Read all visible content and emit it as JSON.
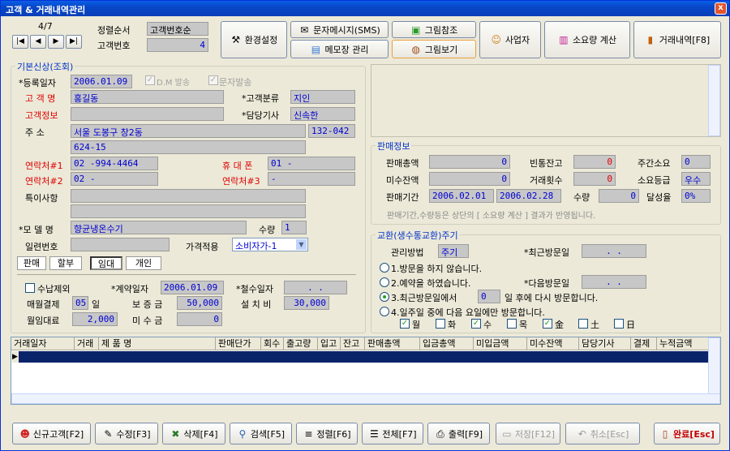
{
  "window": {
    "title": "고객 & 거래내역관리",
    "close": "x"
  },
  "nav": {
    "record": "4/7",
    "first": "|◀",
    "prev": "◀",
    "next": "▶",
    "last": "▶|",
    "sort_label": "정렬순서",
    "sort_value": "고객번호순",
    "custno_label": "고객번호",
    "custno_value": "4"
  },
  "toolbar": {
    "env": "환경설정",
    "sms": "문자메시지(SMS)",
    "photo_ref": "그림참조",
    "business": "사업자",
    "consumption": "소요량 계산",
    "trade": "거래내역[F8]",
    "memo": "메모장 관리",
    "photo_view": "그림보기"
  },
  "basic": {
    "title": "기본신상(조회)",
    "reg_date_label": "*등록일자",
    "reg_date": "2006.01.09",
    "dm_label": "D.M 발송",
    "sms_label": "문자발송",
    "name_label": "고 객 명",
    "name": "홍길동",
    "class_label": "*고객분류",
    "class_value": "지인",
    "info_label": "고객정보",
    "info": "",
    "driver_label": "*담당기사",
    "driver": "신속한",
    "addr_label": "주      소",
    "addr1": "서울 도봉구 창2동",
    "zip": "132-042",
    "addr2": "624-15",
    "tel1_label": "연락처#1",
    "tel1": "02  -994-4464",
    "mobile_label": "휴 대 폰",
    "mobile": "01  -",
    "tel2_label": "연락처#2",
    "tel2": "02  -",
    "tel3_label": "연락처#3",
    "tel3": "-",
    "note_label": "특이사항",
    "note1": "",
    "note2": "",
    "model_label": "*모 델 명",
    "model": "향균냉온수기",
    "qty_label": "수량",
    "qty": "1",
    "serial_label": "일련번호",
    "serial": "",
    "price_label": "가격적용",
    "price": "소비자가-1",
    "tabs": [
      "판매",
      "할부",
      "임대",
      "개인"
    ],
    "nocollect_label": "수납제외",
    "contract_label": "*계약일자",
    "contract": "2006.01.09",
    "withdraw_label": "*철수일자",
    "withdraw": ".   .",
    "monthly_label": "매월결제",
    "monthly_day": "05",
    "monthly_unit": "일",
    "deposit_label": "보 증 금",
    "deposit": "50,000",
    "install_label": "설 치 비",
    "install": "30,000",
    "rent_label": "월임대료",
    "rent": "2,000",
    "unpaid_label": "미 수 금",
    "unpaid": "0"
  },
  "sales": {
    "title": "판매정보",
    "total_label": "판매총액",
    "total": "0",
    "empty_label": "빈통잔고",
    "empty": "0",
    "cycle_label": "주간소요",
    "cycle": "0",
    "balance_label": "미수잔액",
    "balance": "0",
    "count_label": "거래횟수",
    "count": "0",
    "grade_label": "소요등급",
    "grade": "우수",
    "period_label": "판매기간",
    "period_from": "2006.02.01",
    "period_to": "2006.02.28",
    "qty_label": "수량",
    "qty": "0",
    "rate_label": "달성율",
    "rate": "0%",
    "note": "판매기간,수량등은 상단의 [ 소요량 계산 ] 결과가 반영됩니다."
  },
  "exchange": {
    "title": "교환(생수통교환)주기",
    "method_label": "관리방법",
    "method": "주기",
    "last_label": "*최근방문일",
    "last": ".   .",
    "next_label": "*다음방문일",
    "next": ".   .",
    "opt1": "1.방문을 하지 않습니다.",
    "opt2": "2.예약을 하였습니다.",
    "opt3a": "3.최근방문일에서",
    "opt3_days": "0",
    "opt3b": "일 후에 다시 방문합니다.",
    "opt4": "4.일주일 중에 다음 요일에만 방문합니다.",
    "days": [
      "월",
      "화",
      "수",
      "목",
      "金",
      "土",
      "日"
    ]
  },
  "grid": {
    "headers": [
      "거래일자",
      "거래",
      "제   품   명",
      "판매단가",
      "회수",
      "출고량",
      "입고",
      "잔고",
      "판매총액",
      "입금총액",
      "미입금액",
      "미수잔액",
      "담당기사",
      "결제",
      "누적금액"
    ]
  },
  "bottom": {
    "new": "신규고객[F2]",
    "edit": "수정[F3]",
    "delete": "삭제[F4]",
    "search": "검색[F5]",
    "sort": "정렬[F6]",
    "all": "전체[F7]",
    "print": "출력[F9]",
    "save": "저장[F12]",
    "cancel": "취소[Esc]",
    "done": "완료[Esc]"
  }
}
